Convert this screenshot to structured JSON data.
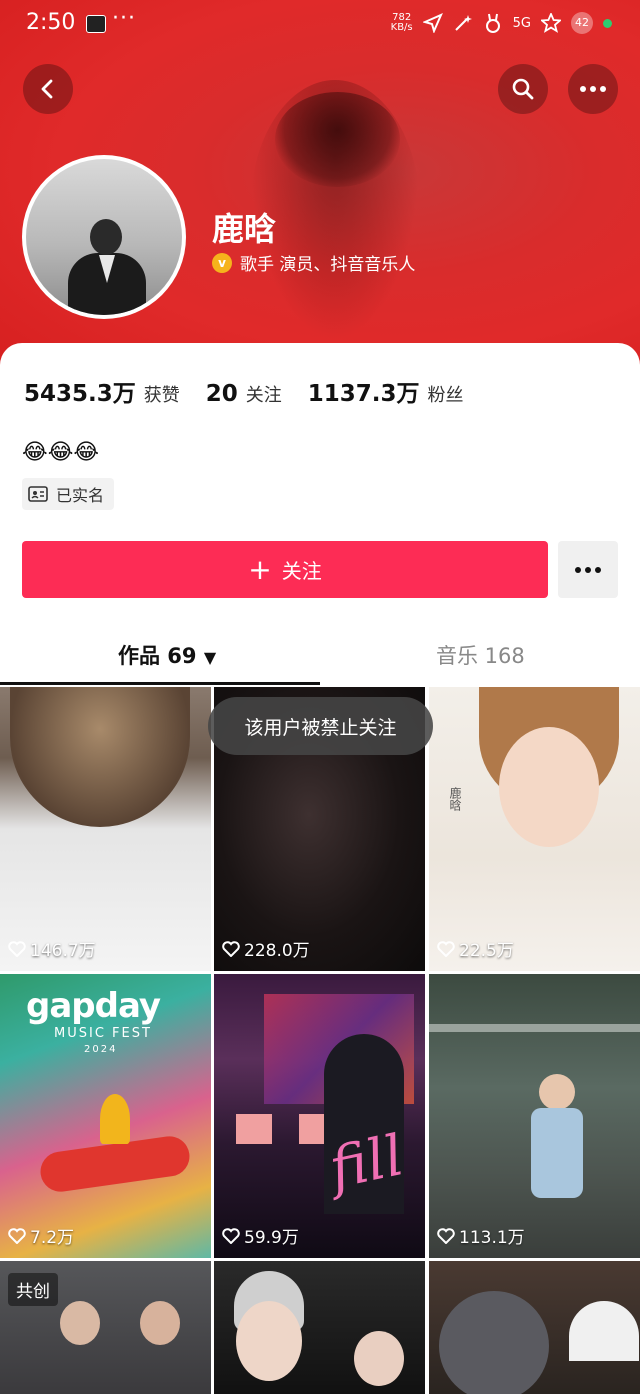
{
  "status_bar": {
    "time": "2:50",
    "dots": "···",
    "net_speed": "782",
    "net_unit": "KB/s",
    "signal": "5G",
    "battery": "42"
  },
  "header": {
    "back_icon": "chevron-left-icon",
    "search_icon": "search-icon",
    "more_icon": "more-dots-icon"
  },
  "profile": {
    "name": "鹿晗",
    "verify_text": "歌手 演员、抖音音乐人",
    "verify_badge": "v",
    "bio_emoji": "😂😂😂",
    "real_name_tag": "已实名"
  },
  "stats": [
    {
      "value": "5435.3万",
      "label": "获赞"
    },
    {
      "value": "20",
      "label": "关注"
    },
    {
      "value": "1137.3万",
      "label": "粉丝"
    }
  ],
  "actions": {
    "follow_label": "关注",
    "follow_plus": "+",
    "more_label": "···"
  },
  "tabs": {
    "works": "作品 69",
    "works_arrow": "▼",
    "music": "音乐 168"
  },
  "toast": "该用户被禁止关注",
  "grid": [
    {
      "likes": "146.7万"
    },
    {
      "likes": "228.0万"
    },
    {
      "likes": "22.5万"
    },
    {
      "likes": "7.2万"
    },
    {
      "likes": "59.9万"
    },
    {
      "likes": "113.1万"
    }
  ],
  "poster": {
    "gapday_title": "gapday",
    "gapday_sub": "MUSIC FEST",
    "gapday_year": "2024",
    "fill_text": "fill",
    "product_name": "鹿晗",
    "co_create_tag": "共创"
  },
  "colors": {
    "header_red": "#e02a2a",
    "follow_button": "#fd2c55"
  }
}
